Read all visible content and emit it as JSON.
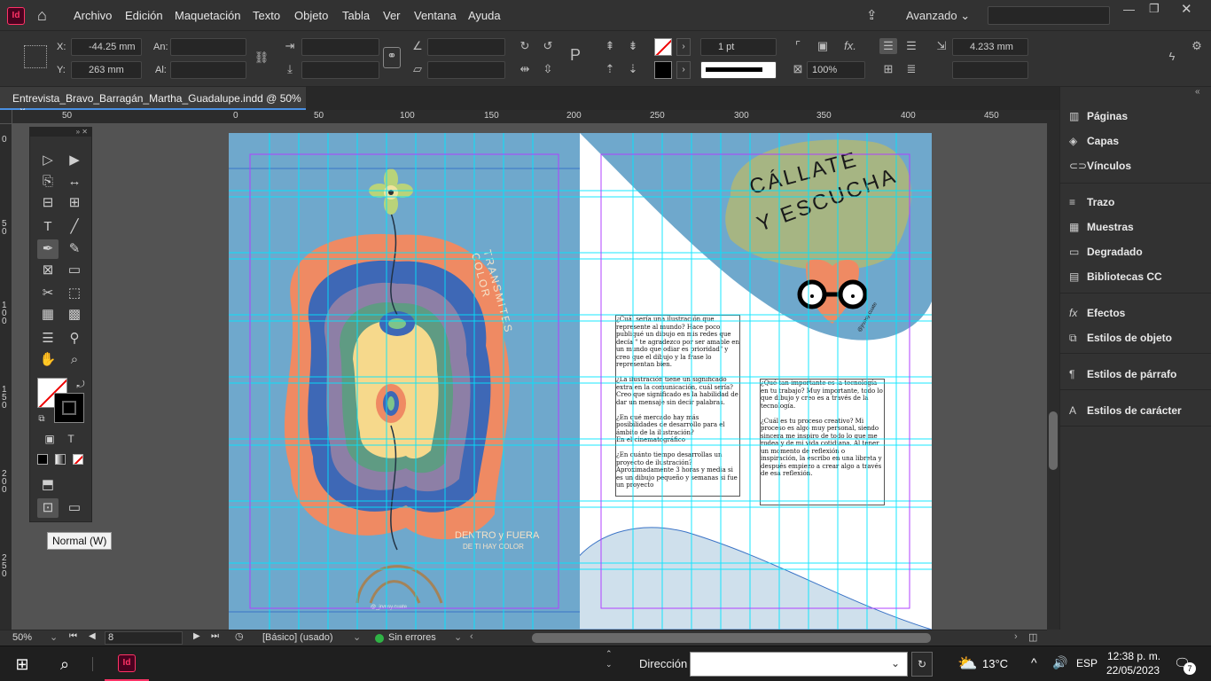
{
  "app": {
    "icon_label": "Id"
  },
  "menu": [
    "Archivo",
    "Edición",
    "Maquetación",
    "Texto",
    "Objeto",
    "Tabla",
    "Ver",
    "Ventana",
    "Ayuda"
  ],
  "workspace": {
    "label": "Avanzado"
  },
  "control": {
    "x_label": "X:",
    "x_value": "-44.25 mm",
    "y_label": "Y:",
    "y_value": "263 mm",
    "w_label": "An:",
    "h_label": "Al:",
    "stroke_weight": "1 pt",
    "opacity": "100%",
    "size_value": "4.233 mm"
  },
  "tab": {
    "title": "Entrevista_Bravo_Barragán_Martha_Guadalupe.indd @ 50%",
    "close": "×"
  },
  "hruler": [
    "50",
    "0",
    "50",
    "100",
    "150",
    "200",
    "250",
    "300",
    "350",
    "400",
    "450"
  ],
  "vruler": [
    "0",
    "50",
    "100",
    "150",
    "200",
    "250"
  ],
  "artwork": {
    "tshirt_text_1": "TRANSMITES COLOR",
    "tshirt_text_2": "DENTRO y FUERA",
    "tshirt_text_3": "DE TI HAY COLOR",
    "signature": "@_jrvnsy.cuate",
    "callate": "CÁLLATE",
    "escucha": "Y ESCUCHA",
    "face_signature": "@jrvnsy.cuate",
    "col1": "¿Cuál sería una ilustración que represente al mundo? Hace poco publiqué un dibujo en mis redes que decía \" te agradezco por ser amable en un mundo que odiar es prioridad\" y creo que el dibujo y la frase lo representan bien.\n\n¿La ilustración tiene un significado extra en la comunicación, cuál sería?\nCreo que significado es la habilidad de dar un mensaje sin decir palabras.\n\n¿En qué mercado hay más posibilidades de desarrollo para el ámbito de la ilustración?\nEn el cinematográfico\n\n¿En cuánto tiempo desarrollas un proyecto de ilustración? Aproximadamente 3 horas y media si es un dibujo pequeño y semanas si fue un proyecto",
    "col2": "¿Qué tan importante es la tecnología en tu trabajo? Muy importante, todo lo que dibujo y creo es a través de la tecnología.\n\n¿Cuál es tu proceso creativo? Mi proceso es algo muy personal, siendo sincera me inspiro de todo lo que me rodea y de mi vida cotidiana. Al tener un momento de reflexión o inspiración, la escribo en una libreta y después empiezo a crear algo a través de esa reflexión."
  },
  "tooltip": "Normal (W)",
  "panels": [
    {
      "icon": "pages-icon",
      "glyph": "▥",
      "label": "Páginas"
    },
    {
      "icon": "layers-icon",
      "glyph": "◈",
      "label": "Capas"
    },
    {
      "icon": "links-icon",
      "glyph": "⊂⊃",
      "label": "Vínculos"
    },
    {
      "icon": "stroke-icon",
      "glyph": "≡",
      "label": "Trazo"
    },
    {
      "icon": "swatches-icon",
      "glyph": "▦",
      "label": "Muestras"
    },
    {
      "icon": "gradient-icon",
      "glyph": "▭",
      "label": "Degradado"
    },
    {
      "icon": "cc-libraries-icon",
      "glyph": "▤",
      "label": "Bibliotecas CC"
    },
    {
      "icon": "effects-icon",
      "glyph": "fx",
      "label": "Efectos"
    },
    {
      "icon": "object-styles-icon",
      "glyph": "⧉",
      "label": "Estilos de objeto"
    },
    {
      "icon": "paragraph-styles-icon",
      "glyph": "¶",
      "label": "Estilos de párrafo"
    },
    {
      "icon": "character-styles-icon",
      "glyph": "A",
      "label": "Estilos de carácter"
    }
  ],
  "status": {
    "zoom": "50%",
    "page": "8",
    "style": "[Básico] (usado)",
    "errors": "Sin errores"
  },
  "taskbar": {
    "search_label": "Dirección",
    "temperature": "13°C",
    "language": "ESP",
    "time": "12:38 p. m.",
    "date": "22/05/2023",
    "notifications": "7"
  },
  "colors": {
    "accent": "#4a90e2",
    "page_bg": "#6fa8cc",
    "guide": "#00e5ff",
    "margin": "#b040ff"
  }
}
